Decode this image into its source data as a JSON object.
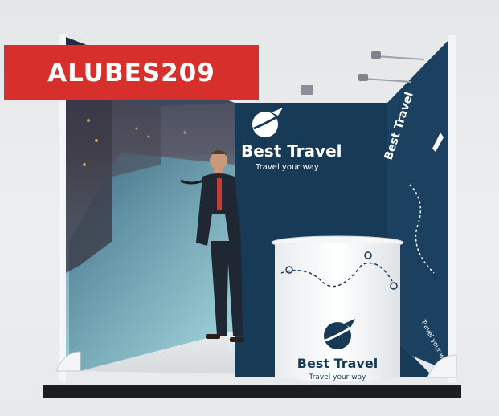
{
  "product_label": "ALUBES209",
  "wall_brand": {
    "name": "Best Travel",
    "tagline": "Travel your way"
  },
  "counter_brand": {
    "name": "Best Travel",
    "tagline": "Travel your way"
  },
  "side_wall_text": "Best Travel",
  "side_wall_lower_text": "Travel your way",
  "colors": {
    "label_red": "#d7302c",
    "booth_navy": "#173a57",
    "white": "#ffffff"
  },
  "icons": [
    "plane-globe-logo-icon",
    "plane-icon",
    "map-pin-icon"
  ]
}
